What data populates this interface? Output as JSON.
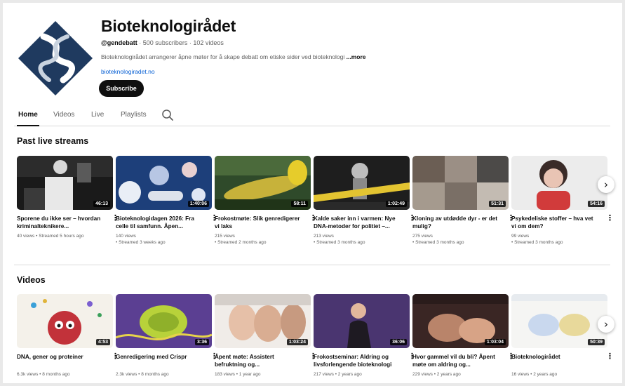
{
  "channel": {
    "name": "Bioteknologirådet",
    "handle": "@gendebatt",
    "stats": "· 500 subscribers · 102 videos",
    "description": "Bioteknologirådet arrangerer åpne møter for å skape debatt om etiske sider ved bioteknologi",
    "more": "...more",
    "link": "bioteknologiradet.no",
    "subscribe": "Subscribe"
  },
  "tabs": [
    "Home",
    "Videos",
    "Live",
    "Playlists"
  ],
  "sections": {
    "live_title": "Past live streams",
    "videos_title": "Videos"
  },
  "live_streams": [
    {
      "title": "Sporene du ikke ser – hvordan kriminalteknikere...",
      "views": "40 views",
      "age": "• Streamed 5 hours ago",
      "duration": "46:13"
    },
    {
      "title": "Bioteknologidagen 2026: Fra celle til samfunn. Åpen...",
      "views": "140 views",
      "age": "• Streamed 3 weeks ago",
      "duration": "1:40:06"
    },
    {
      "title": "Frokostmøte: Slik genredigerer vi laks",
      "views": "215 views",
      "age": "• Streamed 2 months ago",
      "duration": "58:11"
    },
    {
      "title": "Kalde saker inn i varmen: Nye DNA-metoder for politiet –...",
      "views": "213 views",
      "age": "• Streamed 3 months ago",
      "duration": "1:02:49"
    },
    {
      "title": "Kloning av utdødde dyr - er det mulig?",
      "views": "275 views",
      "age": "• Streamed 3 months ago",
      "duration": "51:31"
    },
    {
      "title": "Psykedeliske stoffer – hva vet vi om dem?",
      "views": "99 views",
      "age": "• Streamed 3 months ago",
      "duration": "54:16"
    }
  ],
  "videos": [
    {
      "title": "DNA, gener og proteiner",
      "views": "6.3k views",
      "age": "• 8 months ago",
      "duration": "4:53"
    },
    {
      "title": "Genredigering med Crispr",
      "views": "2.3k views",
      "age": "• 8 months ago",
      "duration": "3:36"
    },
    {
      "title": "Åpent møte: Assistert befruktning og...",
      "views": "183 views",
      "age": "• 1 year ago",
      "duration": "1:03:24"
    },
    {
      "title": "Frokostseminar: Aldring og livsforlengende bioteknologi",
      "views": "217 views",
      "age": "• 2 years ago",
      "duration": "36:06"
    },
    {
      "title": "Hvor gammel vil du bli? Åpent møte om aldring og...",
      "views": "229 views",
      "age": "• 2 years ago",
      "duration": "1:03:04"
    },
    {
      "title": "Bioteknologirådet",
      "views": "16 views",
      "age": "• 2 years ago",
      "duration": "50:39"
    }
  ],
  "icons": {
    "search": "search-icon",
    "next": "chevron-right-icon",
    "menu": "more-vert-icon"
  },
  "colors": {
    "logo": "#1f3a5f",
    "subscribe": "#0f0f0f",
    "link": "#065fd4"
  }
}
